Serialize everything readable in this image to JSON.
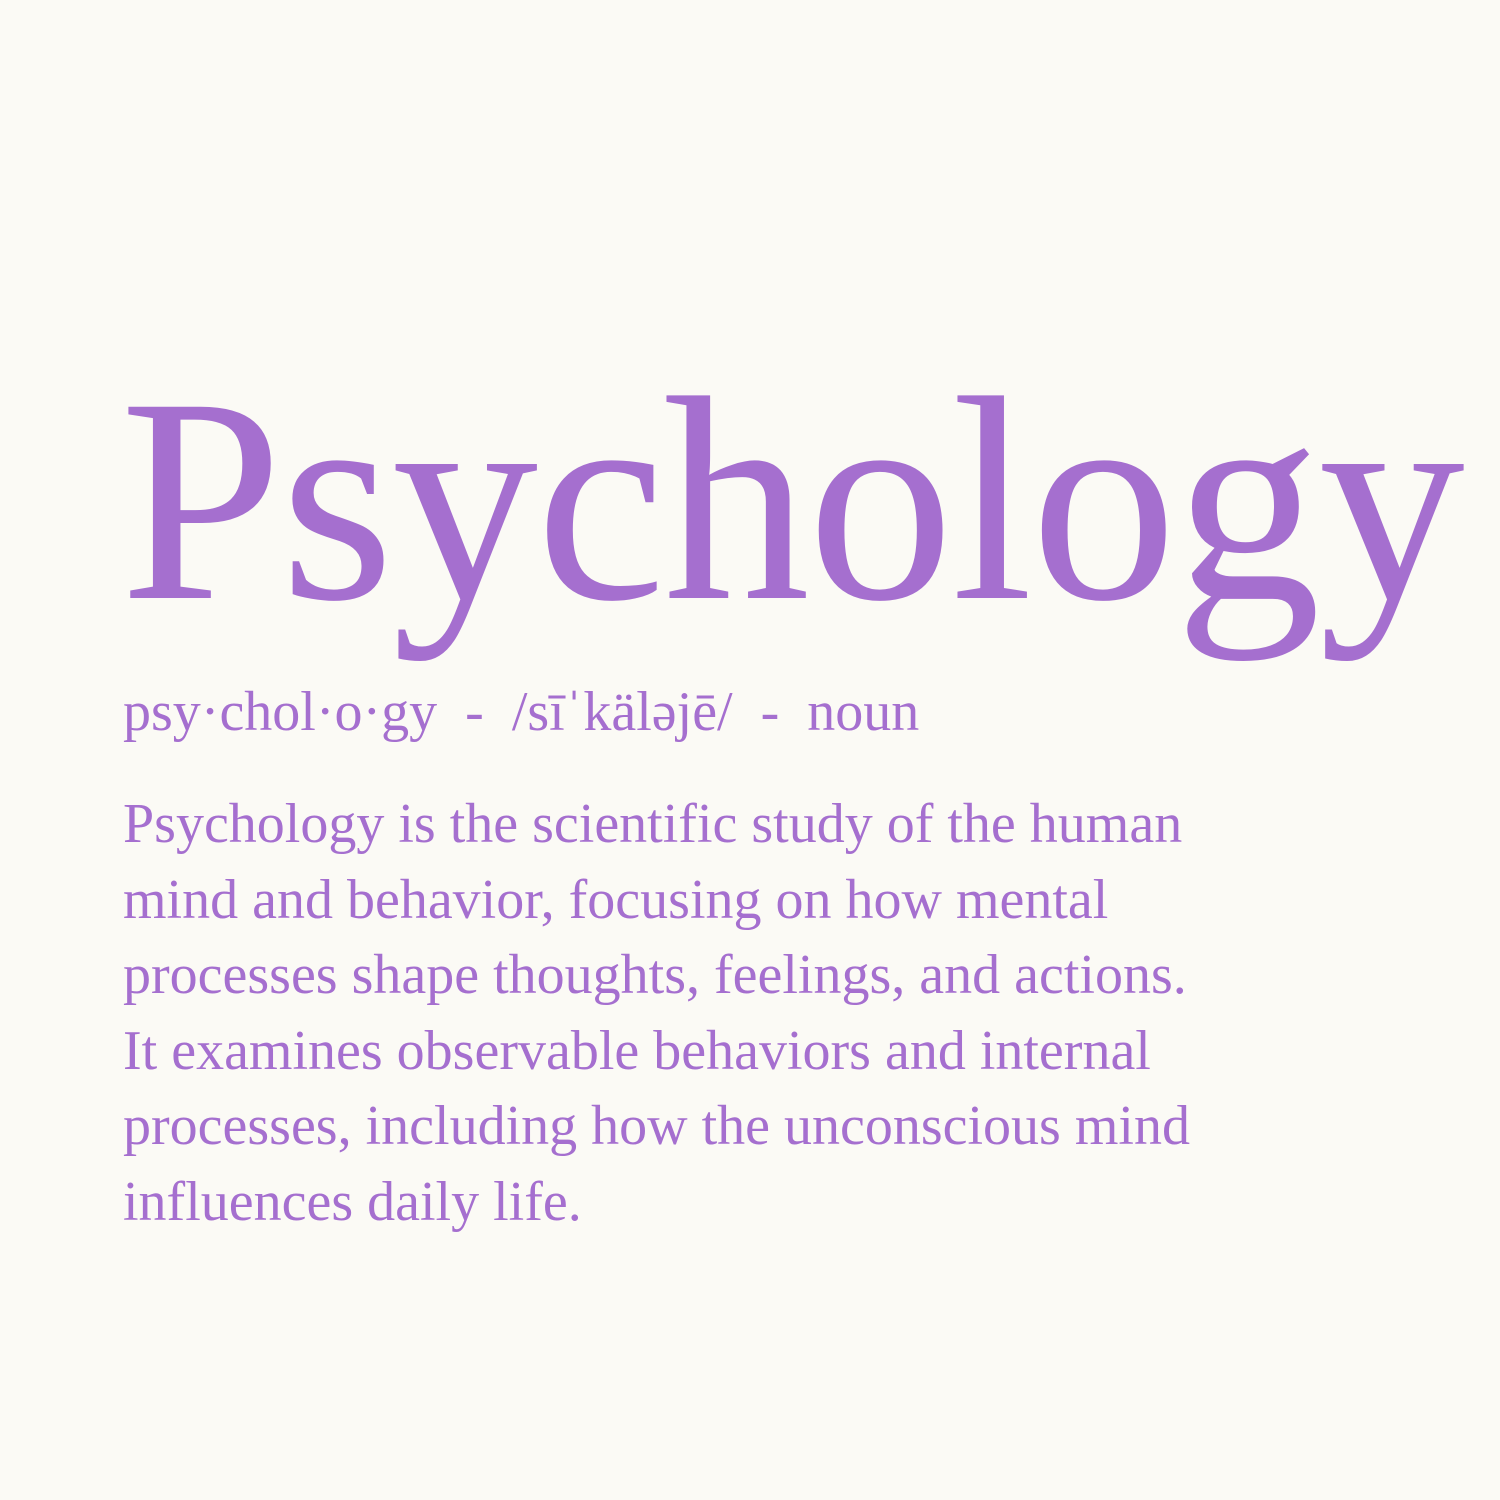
{
  "colors": {
    "background": "#fbfaf5",
    "text": "#a56fcf"
  },
  "entry": {
    "headword": "Psychology",
    "syllables": "psy·chol·o·gy",
    "separator_1": "  -  ",
    "pronunciation": "/sīˈkäləjē/",
    "separator_2": "  -  ",
    "part_of_speech": "noun",
    "definition": " Psychology is the scientific study of the human\nmind and behavior, focusing on how mental\nprocesses shape thoughts, feelings, and actions.\nIt examines observable behaviors and internal\nprocesses, including how the unconscious mind\ninfluences daily life."
  }
}
